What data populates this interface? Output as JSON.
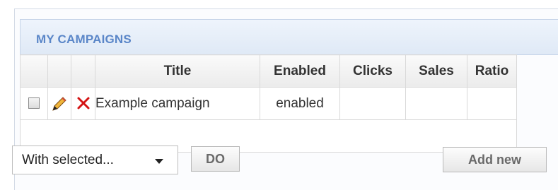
{
  "panel": {
    "title": "MY CAMPAIGNS"
  },
  "table": {
    "columns": [
      "",
      "",
      "",
      "Title",
      "Enabled",
      "Clicks",
      "Sales",
      "Ratio"
    ],
    "rows": [
      {
        "title": "Example campaign",
        "enabled": "enabled",
        "clicks": "",
        "sales": "",
        "ratio": ""
      }
    ]
  },
  "footer": {
    "bulk_select": {
      "selected": "With selected..."
    },
    "do_label": "DO",
    "add_new_label": "Add new"
  },
  "colors": {
    "header_title": "#5a86c8",
    "enabled": "#3a9a2c",
    "delete_icon": "#d41414"
  },
  "icons": {
    "edit": "pencil-icon",
    "delete": "delete-x-icon",
    "dropdown": "chevron-down-icon"
  }
}
